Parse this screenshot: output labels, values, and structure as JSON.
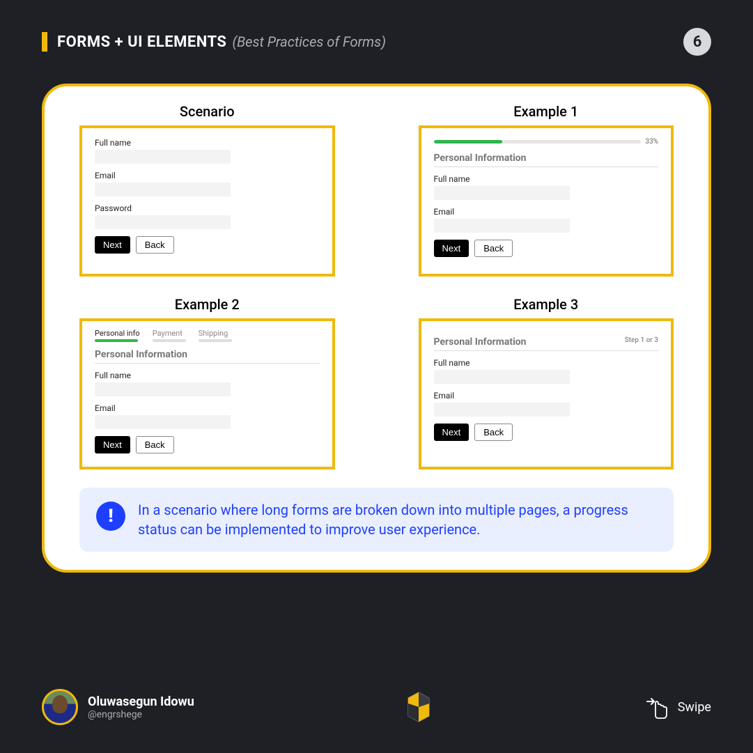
{
  "header": {
    "title": "FORMS + UI ELEMENTS",
    "subtitle": "(Best Practices of Forms)",
    "page_number": "6"
  },
  "panels": {
    "scenario": {
      "title": "Scenario",
      "fields": {
        "fullname": "Full name",
        "email": "Email",
        "password": "Password"
      },
      "next": "Next",
      "back": "Back"
    },
    "example1": {
      "title": "Example 1",
      "progress_pct": "33%",
      "progress_fill_pct": 33,
      "section": "Personal Information",
      "fields": {
        "fullname": "Full name",
        "email": "Email"
      },
      "next": "Next",
      "back": "Back"
    },
    "example2": {
      "title": "Example 2",
      "tabs": [
        "Personal info",
        "Payment",
        "Shipping"
      ],
      "active_tab": 0,
      "section": "Personal Information",
      "fields": {
        "fullname": "Full name",
        "email": "Email"
      },
      "next": "Next",
      "back": "Back"
    },
    "example3": {
      "title": "Example 3",
      "section": "Personal Information",
      "step_text": "Step 1 or 3",
      "fields": {
        "fullname": "Full name",
        "email": "Email"
      },
      "next": "Next",
      "back": "Back"
    }
  },
  "callout": {
    "icon": "!",
    "text": "In a scenario where long forms are broken down into multiple pages, a progress status can be implemented to improve user experience."
  },
  "footer": {
    "author_name": "Oluwasegun Idowu",
    "author_handle": "@engrshege",
    "swipe": "Swipe"
  },
  "colors": {
    "accent": "#f0b90b",
    "bg": "#1e2026",
    "callout_bg": "#e9efff",
    "callout_fg": "#1e3fff",
    "progress_green": "#2fb64d"
  }
}
